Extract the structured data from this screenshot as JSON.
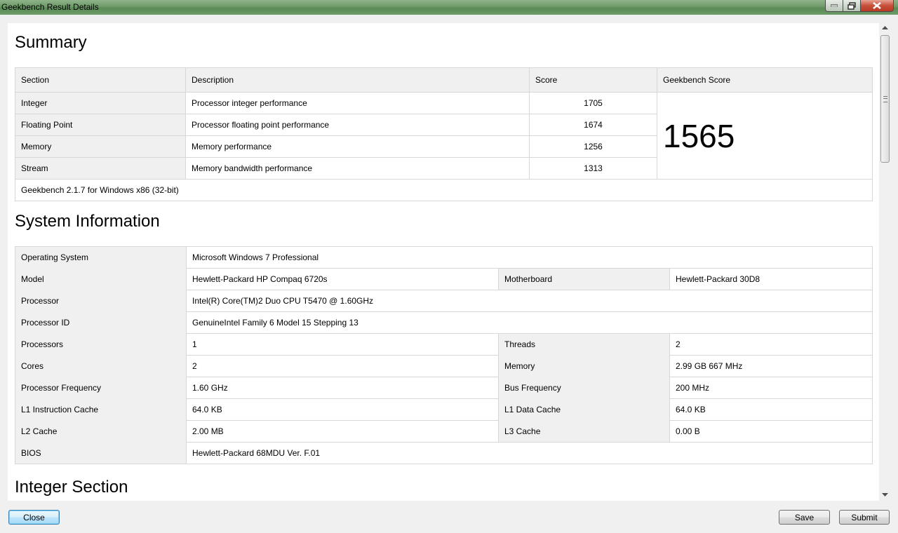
{
  "window": {
    "title": "Geekbench Result Details"
  },
  "summary": {
    "title": "Summary",
    "headers": {
      "section": "Section",
      "description": "Description",
      "score": "Score",
      "geekbench_score": "Geekbench Score"
    },
    "rows": [
      {
        "section": "Integer",
        "description": "Processor integer performance",
        "score": "1705"
      },
      {
        "section": "Floating Point",
        "description": "Processor floating point performance",
        "score": "1674"
      },
      {
        "section": "Memory",
        "description": "Memory performance",
        "score": "1256"
      },
      {
        "section": "Stream",
        "description": "Memory bandwidth performance",
        "score": "1313"
      }
    ],
    "geekbench_score": "1565",
    "version": "Geekbench 2.1.7 for Windows x86 (32-bit)"
  },
  "system": {
    "title": "System Information",
    "os_label": "Operating System",
    "os_value": "Microsoft Windows 7 Professional",
    "model_label": "Model",
    "model_value": "Hewlett-Packard HP Compaq 6720s",
    "motherboard_label": "Motherboard",
    "motherboard_value": "Hewlett-Packard 30D8",
    "processor_label": "Processor",
    "processor_value": "Intel(R) Core(TM)2 Duo CPU T5470 @ 1.60GHz",
    "processor_id_label": "Processor ID",
    "processor_id_value": "GenuineIntel Family 6 Model 15 Stepping 13",
    "processors_label": "Processors",
    "processors_value": "1",
    "threads_label": "Threads",
    "threads_value": "2",
    "cores_label": "Cores",
    "cores_value": "2",
    "memory_label": "Memory",
    "memory_value": "2.99 GB   667 MHz",
    "freq_label": "Processor Frequency",
    "freq_value": "1.60 GHz",
    "bus_label": "Bus Frequency",
    "bus_value": "200 MHz",
    "l1i_label": "L1 Instruction Cache",
    "l1i_value": "64.0 KB",
    "l1d_label": "L1 Data Cache",
    "l1d_value": "64.0 KB",
    "l2_label": "L2 Cache",
    "l2_value": "2.00 MB",
    "l3_label": "L3 Cache",
    "l3_value": "0.00 B",
    "bios_label": "BIOS",
    "bios_value": "Hewlett-Packard 68MDU Ver. F.01"
  },
  "integer_section": {
    "title": "Integer Section"
  },
  "buttons": {
    "close": "Close",
    "save": "Save",
    "submit": "Submit"
  },
  "colors": {
    "titlebar": "#6f9a69",
    "header_bg": "#f0f0f0",
    "border": "#d7d7d7"
  }
}
